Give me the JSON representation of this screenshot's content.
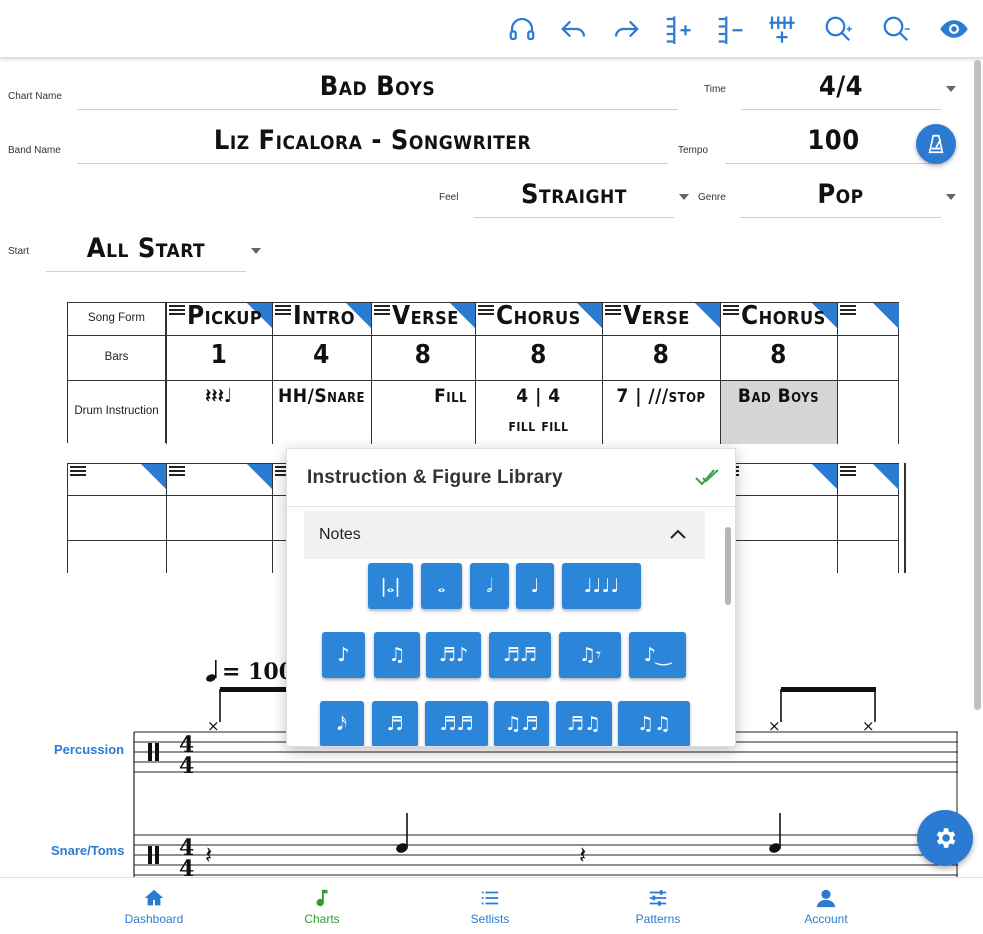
{
  "toolbar": {
    "icons": [
      "headphones-icon",
      "undo-icon",
      "redo-icon",
      "add-bar-icon",
      "remove-bar-icon",
      "add-track-icon",
      "zoom-in-icon",
      "zoom-out-icon",
      "preview-icon"
    ]
  },
  "chart": {
    "chart_name_label": "Chart Name",
    "chart_name": "Bad Boys",
    "band_name_label": "Band Name",
    "band_name": "Liz Ficalora - Songwriter",
    "time_label": "Time",
    "time": "4/4",
    "tempo_label": "Tempo",
    "tempo": "100",
    "feel_label": "Feel",
    "feel": "Straight",
    "genre_label": "Genre",
    "genre": "Pop",
    "start_label": "Start",
    "start": "All Start"
  },
  "song_form": {
    "row_labels": [
      "Song Form",
      "Bars",
      "Drum Instruction"
    ],
    "sections": [
      {
        "name": "Pickup",
        "bars": "1",
        "instruction": "𝄽𝄽𝄽♩"
      },
      {
        "name": "Intro",
        "bars": "4",
        "instruction": "HH/Snare"
      },
      {
        "name": "Verse",
        "bars": "8",
        "instruction": "Fill"
      },
      {
        "name": "Chorus",
        "bars": "8",
        "instruction": "4 | 4",
        "instruction2": "fill fill"
      },
      {
        "name": "Verse",
        "bars": "8",
        "instruction": "7 | ///stop"
      },
      {
        "name": "Chorus",
        "bars": "8",
        "instruction": "Bad Boys"
      },
      {
        "name": "",
        "bars": "",
        "instruction": ""
      }
    ]
  },
  "notation": {
    "tempo_marking": "= 100",
    "instruments": [
      "Percussion",
      "Snare/Toms"
    ]
  },
  "library": {
    "title": "Instruction & Figure Library",
    "section": "Notes",
    "row1": [
      "|𝅝|",
      "𝅝",
      "𝅗𝅥",
      "♩",
      "♩♩♩♩"
    ],
    "row2": [
      "♪",
      "♫",
      "♬♪",
      "♬♬",
      "♫𝄾",
      "♪‿"
    ],
    "row3": [
      "𝅘𝅥𝅯",
      "♬",
      "♬♬",
      "♫♬",
      "♬♫",
      "♫♫"
    ]
  },
  "nav": {
    "items": [
      {
        "label": "Dashboard",
        "icon": "home-icon"
      },
      {
        "label": "Charts",
        "icon": "music-note-icon"
      },
      {
        "label": "Setlists",
        "icon": "list-icon"
      },
      {
        "label": "Patterns",
        "icon": "sliders-icon"
      },
      {
        "label": "Account",
        "icon": "account-icon"
      }
    ],
    "active": "Charts"
  },
  "colors": {
    "accent": "#2b7bd2",
    "active_nav": "#2e9e2e",
    "highlight_cell": "#d6d6d6"
  }
}
